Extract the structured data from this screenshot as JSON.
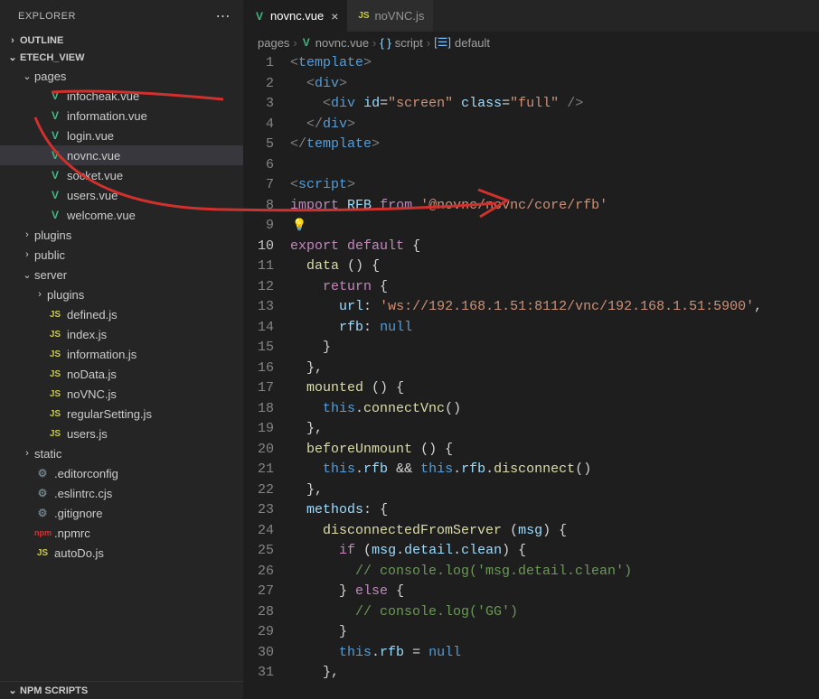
{
  "explorer_label": "EXPLORER",
  "outline_label": "OUTLINE",
  "project_label": "ETECH_VIEW",
  "npm_scripts_label": "NPM SCRIPTS",
  "tree": [
    {
      "d": 1,
      "type": "folder",
      "open": true,
      "label": "pages"
    },
    {
      "d": 2,
      "type": "vue",
      "label": "infocheak.vue"
    },
    {
      "d": 2,
      "type": "vue",
      "label": "information.vue"
    },
    {
      "d": 2,
      "type": "vue",
      "label": "login.vue"
    },
    {
      "d": 2,
      "type": "vue",
      "label": "novnc.vue",
      "sel": true
    },
    {
      "d": 2,
      "type": "vue",
      "label": "socket.vue"
    },
    {
      "d": 2,
      "type": "vue",
      "label": "users.vue"
    },
    {
      "d": 2,
      "type": "vue",
      "label": "welcome.vue"
    },
    {
      "d": 1,
      "type": "folder",
      "open": false,
      "label": "plugins"
    },
    {
      "d": 1,
      "type": "folder",
      "open": false,
      "label": "public"
    },
    {
      "d": 1,
      "type": "folder",
      "open": true,
      "label": "server"
    },
    {
      "d": 2,
      "type": "folder",
      "open": false,
      "label": "plugins"
    },
    {
      "d": 2,
      "type": "js",
      "label": "defined.js"
    },
    {
      "d": 2,
      "type": "js",
      "label": "index.js"
    },
    {
      "d": 2,
      "type": "js",
      "label": "information.js"
    },
    {
      "d": 2,
      "type": "js",
      "label": "noData.js"
    },
    {
      "d": 2,
      "type": "js",
      "label": "noVNC.js"
    },
    {
      "d": 2,
      "type": "js",
      "label": "regularSetting.js"
    },
    {
      "d": 2,
      "type": "js",
      "label": "users.js"
    },
    {
      "d": 1,
      "type": "folder",
      "open": false,
      "label": "static"
    },
    {
      "d": 1,
      "type": "cfg",
      "label": ".editorconfig"
    },
    {
      "d": 1,
      "type": "cfg",
      "label": ".eslintrc.cjs"
    },
    {
      "d": 1,
      "type": "cfg",
      "label": ".gitignore"
    },
    {
      "d": 1,
      "type": "npm",
      "label": ".npmrc"
    },
    {
      "d": 1,
      "type": "js",
      "label": "autoDo.js"
    }
  ],
  "tabs": [
    {
      "icon": "vue",
      "label": "novnc.vue",
      "active": true,
      "close": true
    },
    {
      "icon": "js",
      "label": "noVNC.js",
      "active": false,
      "close": false
    }
  ],
  "breadcrumb": {
    "p0": "pages",
    "p1": "novnc.vue",
    "p2": "script",
    "p3": "default"
  },
  "code": {
    "current_line": 10,
    "lines": [
      {
        "n": 1,
        "t": [
          [
            "c-tag",
            "<"
          ],
          [
            "c-elem",
            "template"
          ],
          [
            "c-tag",
            ">"
          ]
        ]
      },
      {
        "n": 2,
        "t": [
          [
            "c-txt",
            "  "
          ],
          [
            "c-tag",
            "<"
          ],
          [
            "c-elem",
            "div"
          ],
          [
            "c-tag",
            ">"
          ]
        ]
      },
      {
        "n": 3,
        "t": [
          [
            "c-txt",
            "    "
          ],
          [
            "c-tag",
            "<"
          ],
          [
            "c-elem",
            "div"
          ],
          [
            "c-txt",
            " "
          ],
          [
            "c-attr",
            "id"
          ],
          [
            "c-txt",
            "="
          ],
          [
            "c-str",
            "\"screen\""
          ],
          [
            "c-txt",
            " "
          ],
          [
            "c-attr",
            "class"
          ],
          [
            "c-txt",
            "="
          ],
          [
            "c-str",
            "\"full\""
          ],
          [
            "c-txt",
            " "
          ],
          [
            "c-tag",
            "/>"
          ]
        ]
      },
      {
        "n": 4,
        "t": [
          [
            "c-txt",
            "  "
          ],
          [
            "c-tag",
            "</"
          ],
          [
            "c-elem",
            "div"
          ],
          [
            "c-tag",
            ">"
          ]
        ]
      },
      {
        "n": 5,
        "t": [
          [
            "c-tag",
            "</"
          ],
          [
            "c-elem",
            "template"
          ],
          [
            "c-tag",
            ">"
          ]
        ]
      },
      {
        "n": 6,
        "t": []
      },
      {
        "n": 7,
        "t": [
          [
            "c-tag",
            "<"
          ],
          [
            "c-elem",
            "script"
          ],
          [
            "c-tag",
            ">"
          ]
        ]
      },
      {
        "n": 8,
        "t": [
          [
            "c-kw2",
            "import"
          ],
          [
            "c-txt",
            " "
          ],
          [
            "c-var",
            "RFB"
          ],
          [
            "c-txt",
            " "
          ],
          [
            "c-kw2",
            "from"
          ],
          [
            "c-txt",
            " "
          ],
          [
            "c-str",
            "'@novnc/novnc/core/rfb'"
          ]
        ]
      },
      {
        "n": 9,
        "t": [
          [
            "bulb",
            "💡"
          ]
        ]
      },
      {
        "n": 10,
        "t": [
          [
            "c-kw2",
            "export"
          ],
          [
            "c-txt",
            " "
          ],
          [
            "c-kw2",
            "default"
          ],
          [
            "c-txt",
            " "
          ],
          [
            "c-br",
            "{"
          ]
        ]
      },
      {
        "n": 11,
        "t": [
          [
            "c-txt",
            "  "
          ],
          [
            "c-fn",
            "data"
          ],
          [
            "c-txt",
            " "
          ],
          [
            "c-br",
            "()"
          ],
          [
            "c-txt",
            " "
          ],
          [
            "c-br",
            "{"
          ]
        ]
      },
      {
        "n": 12,
        "t": [
          [
            "c-txt",
            "    "
          ],
          [
            "c-kw2",
            "return"
          ],
          [
            "c-txt",
            " "
          ],
          [
            "c-br",
            "{"
          ]
        ]
      },
      {
        "n": 13,
        "t": [
          [
            "c-txt",
            "      "
          ],
          [
            "c-prop",
            "url"
          ],
          [
            "c-txt",
            ":"
          ],
          [
            "c-txt",
            " "
          ],
          [
            "c-str",
            "'ws://192.168.1.51:8112/vnc/192.168.1.51:5900'"
          ],
          [
            "c-txt",
            ","
          ]
        ]
      },
      {
        "n": 14,
        "t": [
          [
            "c-txt",
            "      "
          ],
          [
            "c-prop",
            "rfb"
          ],
          [
            "c-txt",
            ":"
          ],
          [
            "c-txt",
            " "
          ],
          [
            "c-null",
            "null"
          ]
        ]
      },
      {
        "n": 15,
        "t": [
          [
            "c-txt",
            "    "
          ],
          [
            "c-br",
            "}"
          ]
        ]
      },
      {
        "n": 16,
        "t": [
          [
            "c-txt",
            "  "
          ],
          [
            "c-br",
            "}"
          ],
          [
            "c-txt",
            ","
          ]
        ]
      },
      {
        "n": 17,
        "t": [
          [
            "c-txt",
            "  "
          ],
          [
            "c-fn",
            "mounted"
          ],
          [
            "c-txt",
            " "
          ],
          [
            "c-br",
            "()"
          ],
          [
            "c-txt",
            " "
          ],
          [
            "c-br",
            "{"
          ]
        ]
      },
      {
        "n": 18,
        "t": [
          [
            "c-txt",
            "    "
          ],
          [
            "c-this",
            "this"
          ],
          [
            "c-txt",
            "."
          ],
          [
            "c-fn",
            "connectVnc"
          ],
          [
            "c-br",
            "()"
          ]
        ]
      },
      {
        "n": 19,
        "t": [
          [
            "c-txt",
            "  "
          ],
          [
            "c-br",
            "}"
          ],
          [
            "c-txt",
            ","
          ]
        ]
      },
      {
        "n": 20,
        "t": [
          [
            "c-txt",
            "  "
          ],
          [
            "c-fn",
            "beforeUnmount"
          ],
          [
            "c-txt",
            " "
          ],
          [
            "c-br",
            "()"
          ],
          [
            "c-txt",
            " "
          ],
          [
            "c-br",
            "{"
          ]
        ]
      },
      {
        "n": 21,
        "t": [
          [
            "c-txt",
            "    "
          ],
          [
            "c-this",
            "this"
          ],
          [
            "c-txt",
            "."
          ],
          [
            "c-var",
            "rfb"
          ],
          [
            "c-txt",
            " "
          ],
          [
            "c-op",
            "&&"
          ],
          [
            "c-txt",
            " "
          ],
          [
            "c-this",
            "this"
          ],
          [
            "c-txt",
            "."
          ],
          [
            "c-var",
            "rfb"
          ],
          [
            "c-txt",
            "."
          ],
          [
            "c-fn",
            "disconnect"
          ],
          [
            "c-br",
            "()"
          ]
        ]
      },
      {
        "n": 22,
        "t": [
          [
            "c-txt",
            "  "
          ],
          [
            "c-br",
            "}"
          ],
          [
            "c-txt",
            ","
          ]
        ]
      },
      {
        "n": 23,
        "t": [
          [
            "c-txt",
            "  "
          ],
          [
            "c-prop",
            "methods"
          ],
          [
            "c-txt",
            ":"
          ],
          [
            "c-txt",
            " "
          ],
          [
            "c-br",
            "{"
          ]
        ]
      },
      {
        "n": 24,
        "t": [
          [
            "c-txt",
            "    "
          ],
          [
            "c-fn",
            "disconnectedFromServer"
          ],
          [
            "c-txt",
            " "
          ],
          [
            "c-br",
            "("
          ],
          [
            "c-var",
            "msg"
          ],
          [
            "c-br",
            ")"
          ],
          [
            "c-txt",
            " "
          ],
          [
            "c-br",
            "{"
          ]
        ]
      },
      {
        "n": 25,
        "t": [
          [
            "c-txt",
            "      "
          ],
          [
            "c-kw2",
            "if"
          ],
          [
            "c-txt",
            " "
          ],
          [
            "c-br",
            "("
          ],
          [
            "c-var",
            "msg"
          ],
          [
            "c-txt",
            "."
          ],
          [
            "c-var",
            "detail"
          ],
          [
            "c-txt",
            "."
          ],
          [
            "c-var",
            "clean"
          ],
          [
            "c-br",
            ")"
          ],
          [
            "c-txt",
            " "
          ],
          [
            "c-br",
            "{"
          ]
        ]
      },
      {
        "n": 26,
        "t": [
          [
            "c-txt",
            "        "
          ],
          [
            "c-cmt",
            "// console.log('msg.detail.clean')"
          ]
        ]
      },
      {
        "n": 27,
        "t": [
          [
            "c-txt",
            "      "
          ],
          [
            "c-br",
            "}"
          ],
          [
            "c-txt",
            " "
          ],
          [
            "c-kw2",
            "else"
          ],
          [
            "c-txt",
            " "
          ],
          [
            "c-br",
            "{"
          ]
        ]
      },
      {
        "n": 28,
        "t": [
          [
            "c-txt",
            "        "
          ],
          [
            "c-cmt",
            "// console.log('GG')"
          ]
        ]
      },
      {
        "n": 29,
        "t": [
          [
            "c-txt",
            "      "
          ],
          [
            "c-br",
            "}"
          ]
        ]
      },
      {
        "n": 30,
        "t": [
          [
            "c-txt",
            "      "
          ],
          [
            "c-this",
            "this"
          ],
          [
            "c-txt",
            "."
          ],
          [
            "c-var",
            "rfb"
          ],
          [
            "c-txt",
            " "
          ],
          [
            "c-op",
            "="
          ],
          [
            "c-txt",
            " "
          ],
          [
            "c-null",
            "null"
          ]
        ]
      },
      {
        "n": 31,
        "t": [
          [
            "c-txt",
            "    "
          ],
          [
            "c-br",
            "}"
          ],
          [
            "c-txt",
            ","
          ]
        ]
      }
    ]
  }
}
